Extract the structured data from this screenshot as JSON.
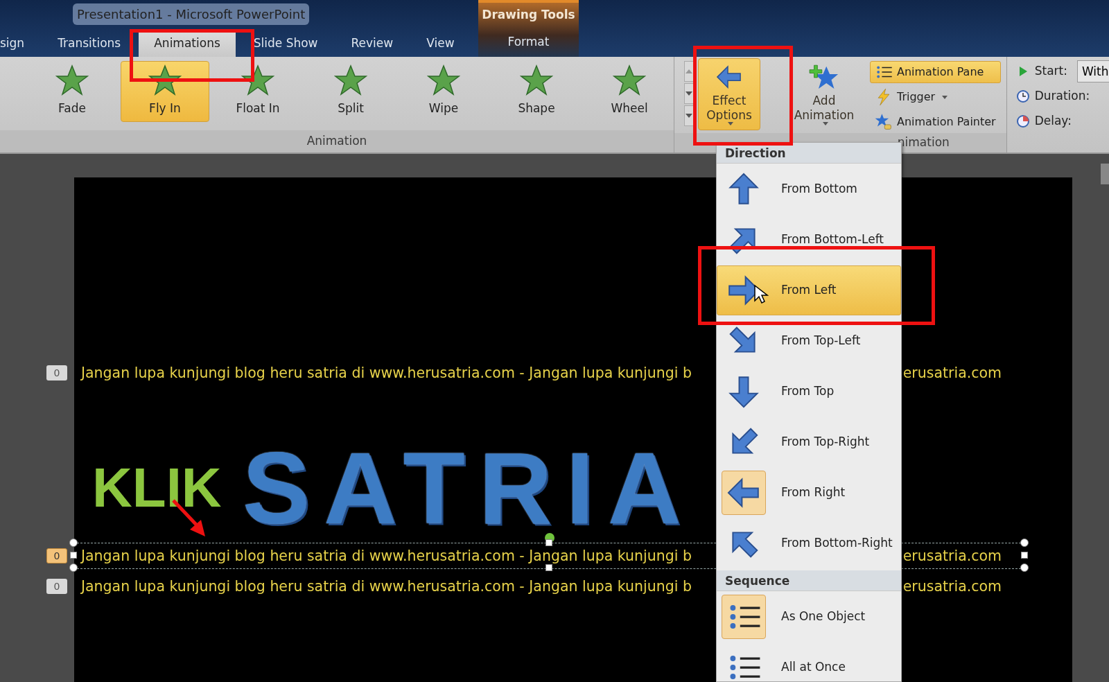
{
  "window": {
    "title": "Presentation1  -  Microsoft PowerPoint"
  },
  "tabs": [
    {
      "label": "sign",
      "selected": false
    },
    {
      "label": "Transitions",
      "selected": false
    },
    {
      "label": "Animations",
      "selected": true
    },
    {
      "label": "Slide Show",
      "selected": false
    },
    {
      "label": "Review",
      "selected": false
    },
    {
      "label": "View",
      "selected": false
    }
  ],
  "contextual_tab": {
    "group": "Drawing Tools",
    "tab": {
      "label": "Format",
      "selected": false
    }
  },
  "ribbon": {
    "animation_gallery": {
      "group_label": "Animation",
      "items": [
        {
          "label": "Fade",
          "selected": false
        },
        {
          "label": "Fly In",
          "selected": true
        },
        {
          "label": "Float In",
          "selected": false
        },
        {
          "label": "Split",
          "selected": false
        },
        {
          "label": "Wipe",
          "selected": false
        },
        {
          "label": "Shape",
          "selected": false
        },
        {
          "label": "Wheel",
          "selected": false
        }
      ]
    },
    "effect_options": {
      "label": "Effect Options",
      "open": true
    },
    "add_animation": {
      "label": "Add Animation"
    },
    "advanced": {
      "group_label": "nimation",
      "items": [
        {
          "label": "Animation Pane",
          "active": true,
          "has_dropdown": false
        },
        {
          "label": "Trigger",
          "active": false,
          "has_dropdown": true
        },
        {
          "label": "Animation Painter",
          "active": false,
          "has_dropdown": false
        }
      ]
    },
    "timing": {
      "start_label": "Start:",
      "start_value": "With",
      "duration_label": "Duration:",
      "delay_label": "Delay:"
    }
  },
  "effect_menu": {
    "sections": [
      {
        "header": "Direction",
        "items": [
          {
            "label": "From Bottom",
            "selected": false,
            "hovered": false
          },
          {
            "label": "From Bottom-Left",
            "selected": false,
            "hovered": false
          },
          {
            "label": "From Left",
            "selected": false,
            "hovered": true
          },
          {
            "label": "From Top-Left",
            "selected": false,
            "hovered": false
          },
          {
            "label": "From Top",
            "selected": false,
            "hovered": false
          },
          {
            "label": "From Top-Right",
            "selected": false,
            "hovered": false
          },
          {
            "label": "From Right",
            "selected": true,
            "hovered": false
          },
          {
            "label": "From Bottom-Right",
            "selected": false,
            "hovered": false
          }
        ]
      },
      {
        "header": "Sequence",
        "items": [
          {
            "label": "As One Object",
            "selected": true,
            "hovered": false
          },
          {
            "label": "All at Once",
            "selected": false,
            "hovered": false
          }
        ]
      }
    ]
  },
  "slide": {
    "title_art": "SATRIA",
    "lines": [
      {
        "badge": "0",
        "selected": false,
        "text": "Jangan lupa kunjungi blog heru satria di www.herusatria.com - Jangan lupa kunjungi b",
        "text_right": "erusatria.com"
      },
      {
        "badge": "0",
        "selected": true,
        "text": "Jangan lupa kunjungi blog heru satria di www.herusatria.com - Jangan lupa kunjungi b",
        "text_right": "erusatria.com"
      },
      {
        "badge": "0",
        "selected": false,
        "text": "Jangan lupa kunjungi blog heru satria di www.herusatria.com - Jangan lupa kunjungi b",
        "text_right": "erusatria.com"
      }
    ]
  },
  "annotations": {
    "callout": "KLIK"
  }
}
